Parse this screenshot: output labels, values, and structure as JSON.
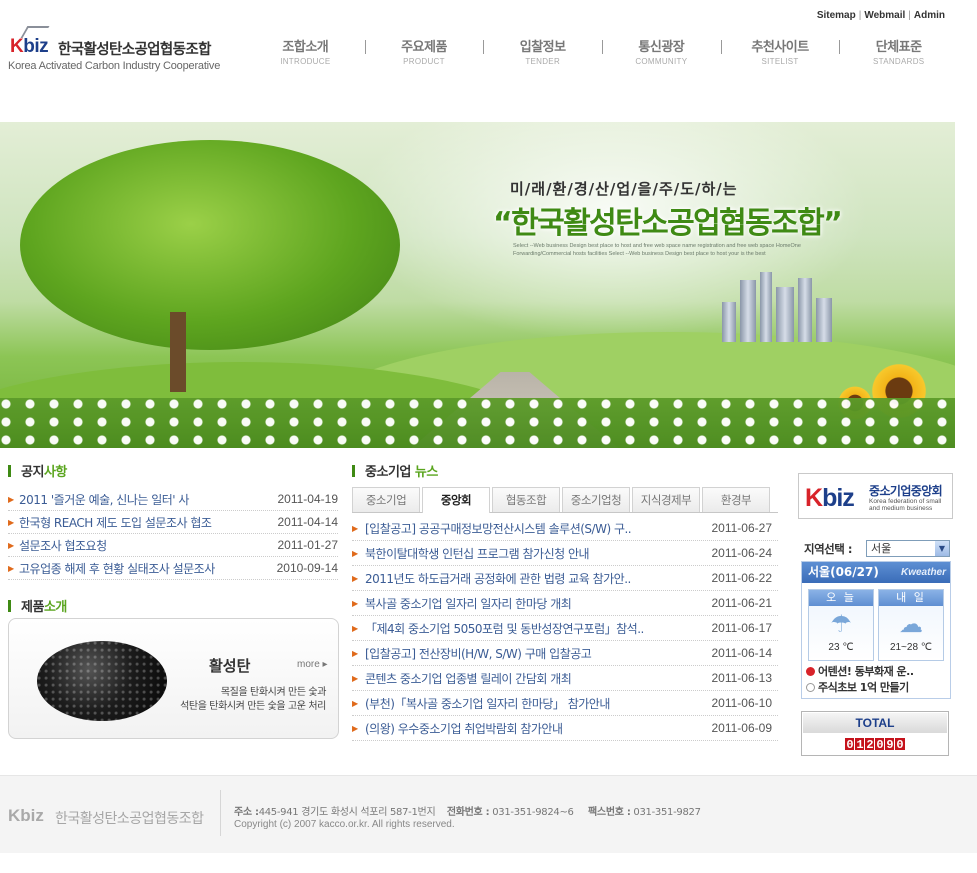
{
  "toplinks": {
    "sitemap": "Sitemap",
    "webmail": "Webmail",
    "admin": "Admin",
    "sep": "|"
  },
  "logo": {
    "mark_k": "K",
    "mark_rest": "biz",
    "kor": "한국활성탄소공업협동조합",
    "eng": "Korea Activated Carbon Industry Cooperative"
  },
  "nav": [
    {
      "ko": "조합소개",
      "en": "INTRODUCE"
    },
    {
      "ko": "주요제품",
      "en": "PRODUCT"
    },
    {
      "ko": "입찰정보",
      "en": "TENDER"
    },
    {
      "ko": "통신광장",
      "en": "COMMUNITY"
    },
    {
      "ko": "추천사이트",
      "en": "SITELIST"
    },
    {
      "ko": "단체표준",
      "en": "STANDARDS"
    }
  ],
  "hero": {
    "slogan_top": "미/래/환/경/산/업/을/주/도/하/는",
    "slogan_main": "“한국활성탄소공업협동조합”",
    "slogan_sub": "Select --Web business Design  best place to host and free web space name registration and free web space  HomeOne Forwarding/Commercial hosts facilities  Select --Web business Design  best place to host your is the best"
  },
  "notice": {
    "title_a": "공지",
    "title_b": "사항",
    "items": [
      {
        "title": "2011 '즐거운 예술, 신나는 일터' 사",
        "date": "2011-04-19"
      },
      {
        "title": "한국형 REACH 제도 도입 설문조사 협조",
        "date": "2011-04-14"
      },
      {
        "title": "설문조사 협조요청",
        "date": "2011-01-27"
      },
      {
        "title": "고유업종 해제 후 현황 실태조사 설문조사",
        "date": "2010-09-14"
      }
    ]
  },
  "product": {
    "title_a": "제품",
    "title_b": "소개",
    "name": "활성탄",
    "more": "more ▸",
    "desc1": "목질을 탄화시켜 만든 숯과",
    "desc2": "석탄을 탄화시켜 만든 숯을 고운 처리"
  },
  "news": {
    "title_a": "중소기업",
    "title_b": "뉴스",
    "tabs": [
      "중소기업",
      "중앙회",
      "협동조합",
      "중소기업청",
      "지식경제부",
      "환경부"
    ],
    "active_tab": 1,
    "items": [
      {
        "title": "[입찰공고] 공공구매정보망전산시스템 솔루션(S/W) 구..",
        "date": "2011-06-27"
      },
      {
        "title": "북한이탈대학생 인턴십 프로그램 참가신청 안내",
        "date": "2011-06-24"
      },
      {
        "title": "2011년도 하도급거래 공정화에 관한 법령 교육 참가안..",
        "date": "2011-06-22"
      },
      {
        "title": "복사골 중소기업 일자리 일자리 한마당 개최",
        "date": "2011-06-21"
      },
      {
        "title": "「제4회 중소기업 5050포럼 및 동반성장연구포럼」참석..",
        "date": "2011-06-17"
      },
      {
        "title": "[입찰공고] 전산장비(H/W, S/W) 구매 입찰공고",
        "date": "2011-06-14"
      },
      {
        "title": "콘텐츠 중소기업 업종별 릴레이 간담회 개최",
        "date": "2011-06-13"
      },
      {
        "title": "(부천)「복사골 중소기업 일자리 한마당」 참가안내",
        "date": "2011-06-10"
      },
      {
        "title": "(의왕) 우수중소기업 취업박람회 참가안내",
        "date": "2011-06-09"
      }
    ]
  },
  "kbiz_banner": {
    "mark_k": "K",
    "mark_rest": "biz",
    "kor": "중소기업중앙회",
    "eng": "Korea federation of small and medium business"
  },
  "region": {
    "label": "지역선택 :",
    "selected": "서울",
    "dropdown_glyph": "▼"
  },
  "weather": {
    "header": "서울(06/27)",
    "brand": "Kweather",
    "today": {
      "label": "오 늘",
      "icon": "umbrella-rain-icon",
      "temp": "23 ℃"
    },
    "tomorrow": {
      "label": "내 일",
      "icon": "cloudy-icon",
      "temp": "21~28 ℃"
    },
    "ticker": [
      "어텐션! 동부화재 운..",
      "주식초보 1억 만들기"
    ]
  },
  "total": {
    "label": "TOTAL",
    "digits": [
      "0",
      "1",
      "2",
      "0",
      "9",
      "0"
    ]
  },
  "footer": {
    "logo_k": "K",
    "logo_rest": "biz",
    "kor": "한국활성탄소공업협동조합",
    "address_label": "주소 :",
    "address": "445-941 경기도 화성시 석포리 587-1번지",
    "tel_label": "전화번호 :",
    "tel": "031-351-9824~6",
    "fax_label": "팩스번호 :",
    "fax": "031-351-9827",
    "copyright": "Copyright (c) 2007 kacco.or.kr. All rights reserved."
  }
}
